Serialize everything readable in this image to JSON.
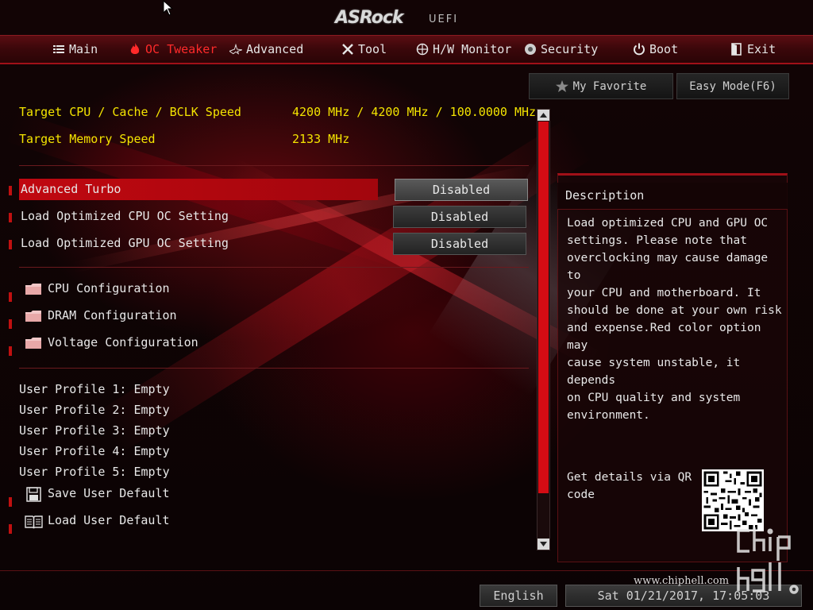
{
  "header": {
    "brand": "ASRock",
    "subtitle": "UEFI"
  },
  "nav": {
    "tabs": [
      {
        "label": "Main",
        "icon": "list-icon",
        "active": false
      },
      {
        "label": "OC Tweaker",
        "icon": "flame-icon",
        "active": true
      },
      {
        "label": "Advanced",
        "icon": "star-icon",
        "active": false
      },
      {
        "label": "Tool",
        "icon": "tools-icon",
        "active": false
      },
      {
        "label": "H/W Monitor",
        "icon": "monitor-icon",
        "active": false
      },
      {
        "label": "Security",
        "icon": "shield-icon",
        "active": false
      },
      {
        "label": "Boot",
        "icon": "power-icon",
        "active": false
      },
      {
        "label": "Exit",
        "icon": "exit-icon",
        "active": false
      }
    ]
  },
  "info": {
    "cpu_label": "Target CPU / Cache / BCLK Speed",
    "cpu_value": "4200 MHz / 4200 MHz / 100.0000 MHz",
    "mem_label": "Target Memory Speed",
    "mem_value": "2133 MHz"
  },
  "settings": [
    {
      "label": "Advanced Turbo",
      "value": "Disabled",
      "selected": true
    },
    {
      "label": "Load Optimized CPU OC Setting",
      "value": "Disabled",
      "selected": false
    },
    {
      "label": "Load Optimized GPU OC Setting",
      "value": "Disabled",
      "selected": false
    }
  ],
  "submenus": [
    {
      "label": "CPU Configuration"
    },
    {
      "label": "DRAM Configuration"
    },
    {
      "label": "Voltage Configuration"
    }
  ],
  "profiles": [
    "User Profile 1: Empty",
    "User Profile 2: Empty",
    "User Profile 3: Empty",
    "User Profile 4: Empty",
    "User Profile 5: Empty"
  ],
  "actions": {
    "save": "Save User Default",
    "load": "Load User Default"
  },
  "right": {
    "favorite": "My Favorite",
    "easy_mode": "Easy Mode(F6)",
    "description_title": "Description",
    "description_lines": [
      "Load optimized CPU and GPU OC",
      "settings. Please note that",
      "overclocking may cause damage to",
      "your CPU and motherboard. It",
      "should be done at your own risk",
      "and expense.Red color option may",
      "cause system unstable, it depends",
      "on CPU quality and system",
      "environment."
    ],
    "qr_lines": [
      "Get details via QR",
      "code"
    ]
  },
  "footer": {
    "language": "English",
    "datetime": "Sat 01/21/2017, 17:05:03",
    "watermark": "www.chiphell.com"
  },
  "colors": {
    "accent": "#d40c14",
    "info_text": "#f4e400",
    "active_tab": "#ff2a2a"
  }
}
